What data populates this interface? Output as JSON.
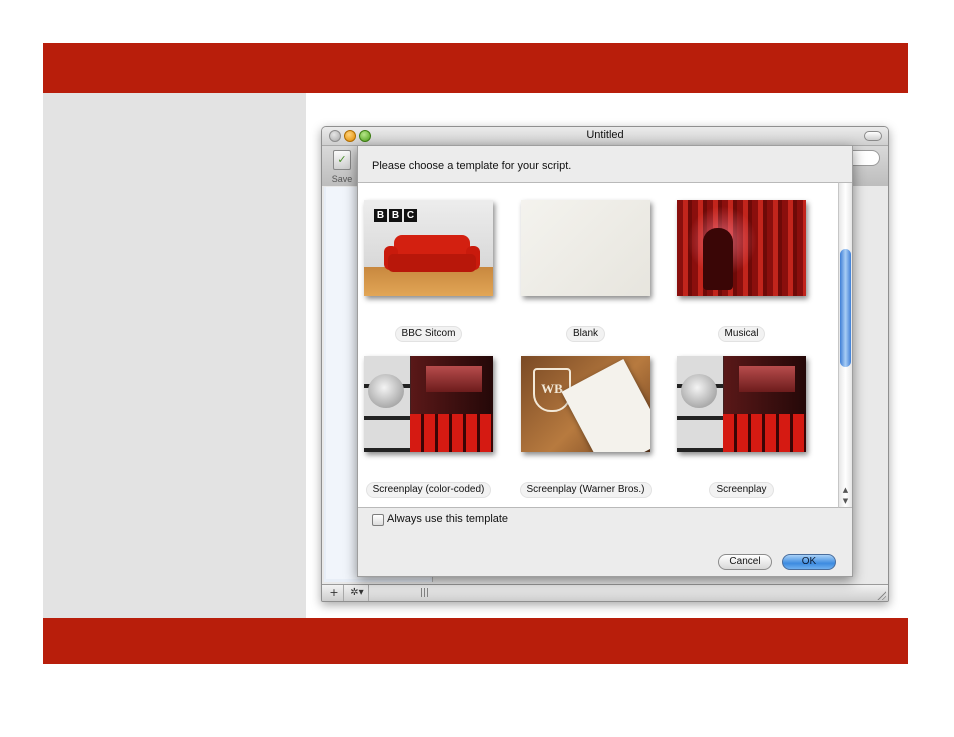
{
  "window": {
    "title": "Untitled",
    "toolbar": {
      "save_label": "Save"
    }
  },
  "dialog": {
    "prompt": "Please choose a template for your script.",
    "templates": [
      {
        "label": "BBC Sitcom",
        "logo_text": [
          "B",
          "B",
          "C"
        ]
      },
      {
        "label": "Blank"
      },
      {
        "label": "Musical"
      },
      {
        "label": "Screenplay (color-coded)"
      },
      {
        "label": "Screenplay (Warner Bros.)",
        "logo_text": "WB"
      },
      {
        "label": "Screenplay"
      }
    ],
    "always_use_label": "Always use this template",
    "always_use_checked": false,
    "cancel_label": "Cancel",
    "ok_label": "OK"
  },
  "bottom_bar": {
    "add_symbol": "+",
    "gear_symbol": "✲▾"
  },
  "colors": {
    "banner": "#b81e0b",
    "left_panel": "#e3e3e3",
    "ok_button": "#3d8be0",
    "scroll_thumb": "#3f7fd6"
  },
  "icons": {
    "save": "save-icon",
    "add": "plus-icon",
    "gear": "gear-icon",
    "scroll_up": "chevron-up-icon",
    "scroll_down": "chevron-down-icon"
  }
}
